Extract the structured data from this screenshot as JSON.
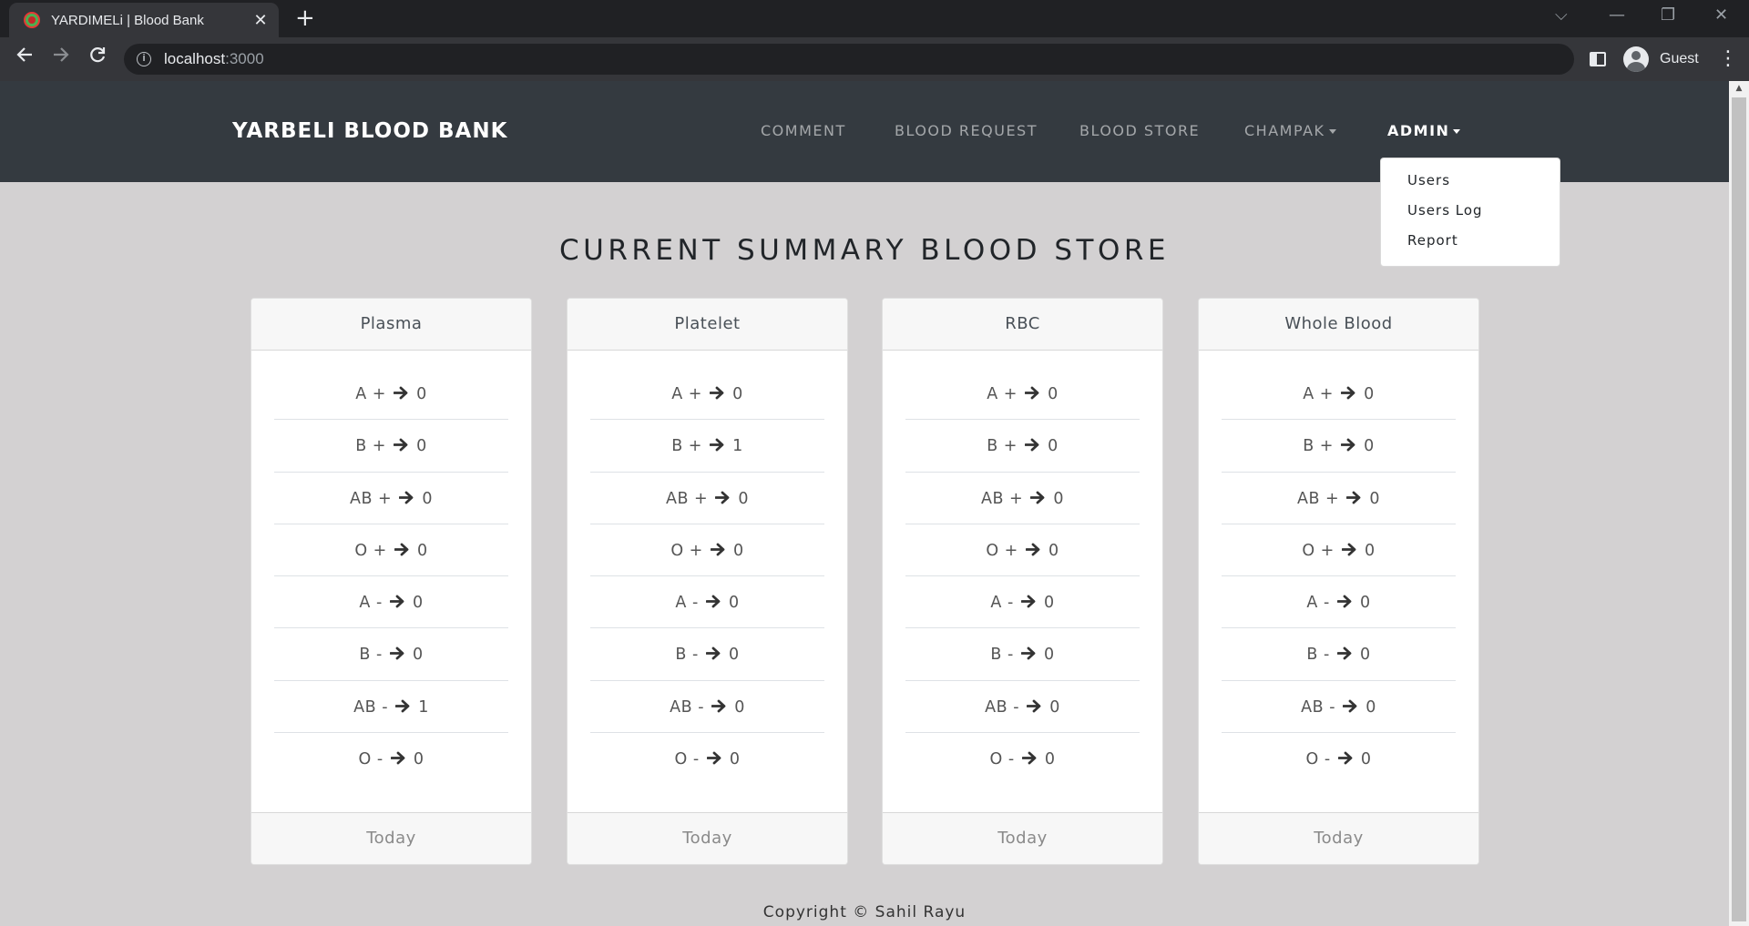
{
  "browser": {
    "tab_title": "YARDIMELi | Blood Bank",
    "tab_close": "✕",
    "new_tab": "+",
    "url_host": "localhost",
    "url_port": ":3000",
    "profile_label": "Guest",
    "window_controls": {
      "tab_search": "⌵",
      "minimize": "—",
      "restore": "❐",
      "close": "✕"
    }
  },
  "navbar": {
    "brand": "YARBELI BLOOD BANK",
    "links": {
      "comment": "COMMENT",
      "blood_request": "BLOOD REQUEST",
      "blood_store": "BLOOD STORE",
      "champak": "CHAMPAK",
      "admin": "ADMIN"
    }
  },
  "admin_dropdown": {
    "items": [
      "Users",
      "Users Log",
      "Report"
    ]
  },
  "page": {
    "title": "CURRENT SUMMARY BLOOD STORE",
    "footer": "Copyright © Sahil Rayu"
  },
  "cards": [
    {
      "title": "Plasma",
      "footer": "Today",
      "rows": [
        {
          "group": "A +",
          "count": "0"
        },
        {
          "group": "B +",
          "count": "0"
        },
        {
          "group": "AB +",
          "count": "0"
        },
        {
          "group": "O +",
          "count": "0"
        },
        {
          "group": "A -",
          "count": "0"
        },
        {
          "group": "B -",
          "count": "0"
        },
        {
          "group": "AB -",
          "count": "1"
        },
        {
          "group": "O -",
          "count": "0"
        }
      ]
    },
    {
      "title": "Platelet",
      "footer": "Today",
      "rows": [
        {
          "group": "A +",
          "count": "0"
        },
        {
          "group": "B +",
          "count": "1"
        },
        {
          "group": "AB +",
          "count": "0"
        },
        {
          "group": "O +",
          "count": "0"
        },
        {
          "group": "A -",
          "count": "0"
        },
        {
          "group": "B -",
          "count": "0"
        },
        {
          "group": "AB -",
          "count": "0"
        },
        {
          "group": "O -",
          "count": "0"
        }
      ]
    },
    {
      "title": "RBC",
      "footer": "Today",
      "rows": [
        {
          "group": "A +",
          "count": "0"
        },
        {
          "group": "B +",
          "count": "0"
        },
        {
          "group": "AB +",
          "count": "0"
        },
        {
          "group": "O +",
          "count": "0"
        },
        {
          "group": "A -",
          "count": "0"
        },
        {
          "group": "B -",
          "count": "0"
        },
        {
          "group": "AB -",
          "count": "0"
        },
        {
          "group": "O -",
          "count": "0"
        }
      ]
    },
    {
      "title": "Whole Blood",
      "footer": "Today",
      "rows": [
        {
          "group": "A +",
          "count": "0"
        },
        {
          "group": "B +",
          "count": "0"
        },
        {
          "group": "AB +",
          "count": "0"
        },
        {
          "group": "O +",
          "count": "0"
        },
        {
          "group": "A -",
          "count": "0"
        },
        {
          "group": "B -",
          "count": "0"
        },
        {
          "group": "AB -",
          "count": "0"
        },
        {
          "group": "O -",
          "count": "0"
        }
      ]
    }
  ],
  "icons": {
    "arrow": "arrow-right-icon"
  },
  "colors": {
    "navbar_bg": "#343a40",
    "page_bg": "#d3d1d2",
    "card_bg": "#ffffff",
    "card_header_bg": "#f7f7f7"
  }
}
